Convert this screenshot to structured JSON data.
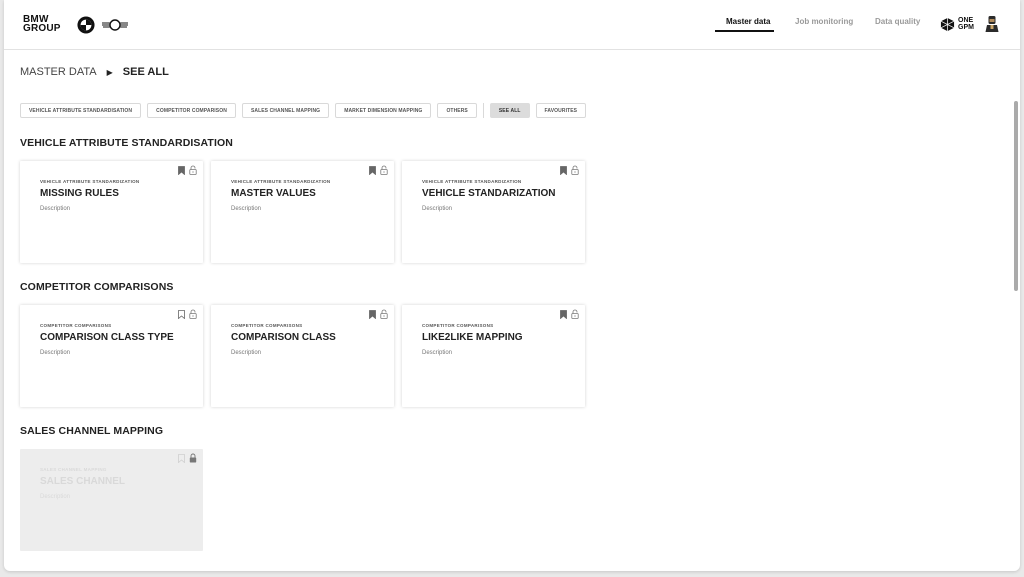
{
  "header": {
    "brand_line1": "BMW",
    "brand_line2": "GROUP",
    "nav": [
      {
        "label": "Master data",
        "active": true
      },
      {
        "label": "Job monitoring",
        "active": false
      },
      {
        "label": "Data quality",
        "active": false
      }
    ],
    "onegpm_line1": "ONE",
    "onegpm_line2": "GPM"
  },
  "breadcrumb": {
    "root": "MASTER DATA",
    "current": "SEE ALL"
  },
  "filters": [
    {
      "label": "VEHICLE ATTRIBUTE STANDARDISATION",
      "active": false
    },
    {
      "label": "COMPETITOR COMPARISON",
      "active": false
    },
    {
      "label": "SALES CHANNEL MAPPING",
      "active": false
    },
    {
      "label": "MARKET DIMENSION MAPPING",
      "active": false
    },
    {
      "label": "OTHERS",
      "active": false
    },
    {
      "label": "SEE ALL",
      "active": true
    },
    {
      "label": "FAVOURITES",
      "active": false
    }
  ],
  "sections": [
    {
      "title": "VEHICLE ATTRIBUTE STANDARDISATION",
      "cards": [
        {
          "eyebrow": "VEHICLE ATTRIBUTE STANDARDIZATION",
          "title": "MISSING RULES",
          "description": "Description",
          "bookmarked": true,
          "locked": false,
          "disabled": false
        },
        {
          "eyebrow": "VEHICLE ATTRIBUTE STANDARDIZATION",
          "title": "MASTER VALUES",
          "description": "Description",
          "bookmarked": true,
          "locked": false,
          "disabled": false
        },
        {
          "eyebrow": "VEHICLE ATTRIBUTE STANDARDIZATION",
          "title": "VEHICLE STANDARIZATION",
          "description": "Description",
          "bookmarked": true,
          "locked": false,
          "disabled": false
        }
      ]
    },
    {
      "title": "COMPETITOR COMPARISONS",
      "cards": [
        {
          "eyebrow": "COMPETITOR COMPARISONS",
          "title": "COMPARISON CLASS TYPE",
          "description": "Description",
          "bookmarked": false,
          "locked": false,
          "disabled": false
        },
        {
          "eyebrow": "COMPETITOR COMPARISONS",
          "title": "COMPARISON CLASS",
          "description": "Description",
          "bookmarked": true,
          "locked": false,
          "disabled": false
        },
        {
          "eyebrow": "COMPETITOR COMPARISONS",
          "title": "LIKE2LIKE MAPPING",
          "description": "Description",
          "bookmarked": true,
          "locked": false,
          "disabled": false
        }
      ]
    },
    {
      "title": "SALES CHANNEL MAPPING",
      "cards": [
        {
          "eyebrow": "SALES CHANNEL MAPPING",
          "title": "SALES CHANNEL",
          "description": "Description",
          "bookmarked": false,
          "locked": true,
          "disabled": true
        }
      ]
    }
  ],
  "icons": {
    "bookmark": "bookmark-icon",
    "lock": "lock-icon",
    "user": "user-avatar-icon"
  }
}
